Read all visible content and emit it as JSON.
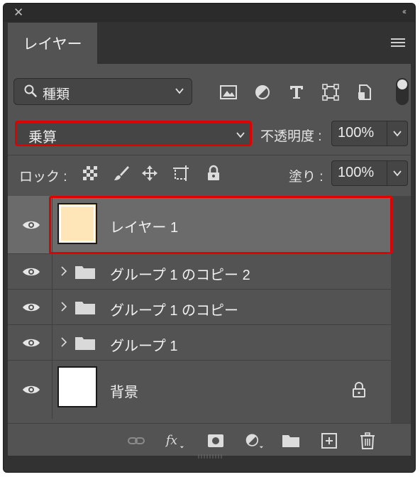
{
  "panel": {
    "tab_label": "レイヤー",
    "collapse_glyph": "‹‹",
    "close_glyph": "✕"
  },
  "filter": {
    "label": "種類"
  },
  "blend": {
    "mode": "乗算",
    "opacity_label": "不透明度 :",
    "opacity_value": "100%"
  },
  "lock": {
    "label": "ロック :",
    "fill_label": "塗り :",
    "fill_value": "100%"
  },
  "layers": [
    {
      "name": "レイヤー 1",
      "type": "pixel",
      "thumb_color": "#ffe6b8",
      "selected": true
    },
    {
      "name": "グループ 1 のコピー 2",
      "type": "group"
    },
    {
      "name": "グループ 1 のコピー",
      "type": "group"
    },
    {
      "name": "グループ 1",
      "type": "group"
    },
    {
      "name": "背景",
      "type": "background",
      "thumb_color": "#ffffff",
      "locked": true
    }
  ],
  "colors": {
    "highlight": "#e00000",
    "panel_bg": "#535353",
    "selected_row": "#6b6b6b"
  }
}
